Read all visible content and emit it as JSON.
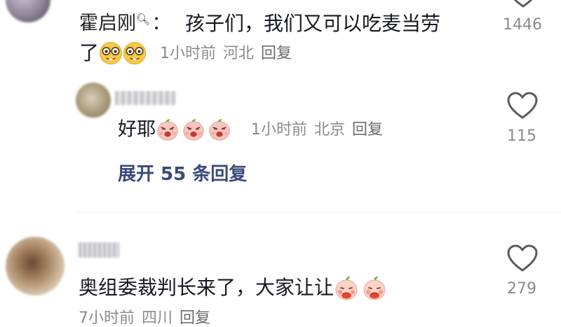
{
  "comments": [
    {
      "author": "霍启刚",
      "separator": "：",
      "text_line1": "孩子们，我们又可以吃麦当劳",
      "text_line2": "了",
      "time": "1小时前",
      "location": "河北",
      "reply_label": "回复",
      "likes": "1446"
    },
    {
      "text": "好耶",
      "time": "1小时前",
      "location": "北京",
      "reply_label": "回复",
      "likes": "115"
    },
    {
      "text": "奥组委裁判长来了，大家让让",
      "time": "7小时前",
      "location": "四川",
      "reply_label": "回复",
      "likes": "279"
    }
  ],
  "expand_replies": "展开 55 条回复",
  "icons": {
    "like": "heart-outline-icon",
    "verified": "search-badge-icon",
    "emoji_nerd": "nerd-glasses-emoji",
    "emoji_angry_pig": "angry-pig-emoji",
    "emoji_shy_peach": "shy-peach-emoji"
  },
  "colors": {
    "text": "#161823",
    "meta": "#8a8b91",
    "expand": "#3a4a7a",
    "heart_stroke": "#5a5b61"
  }
}
